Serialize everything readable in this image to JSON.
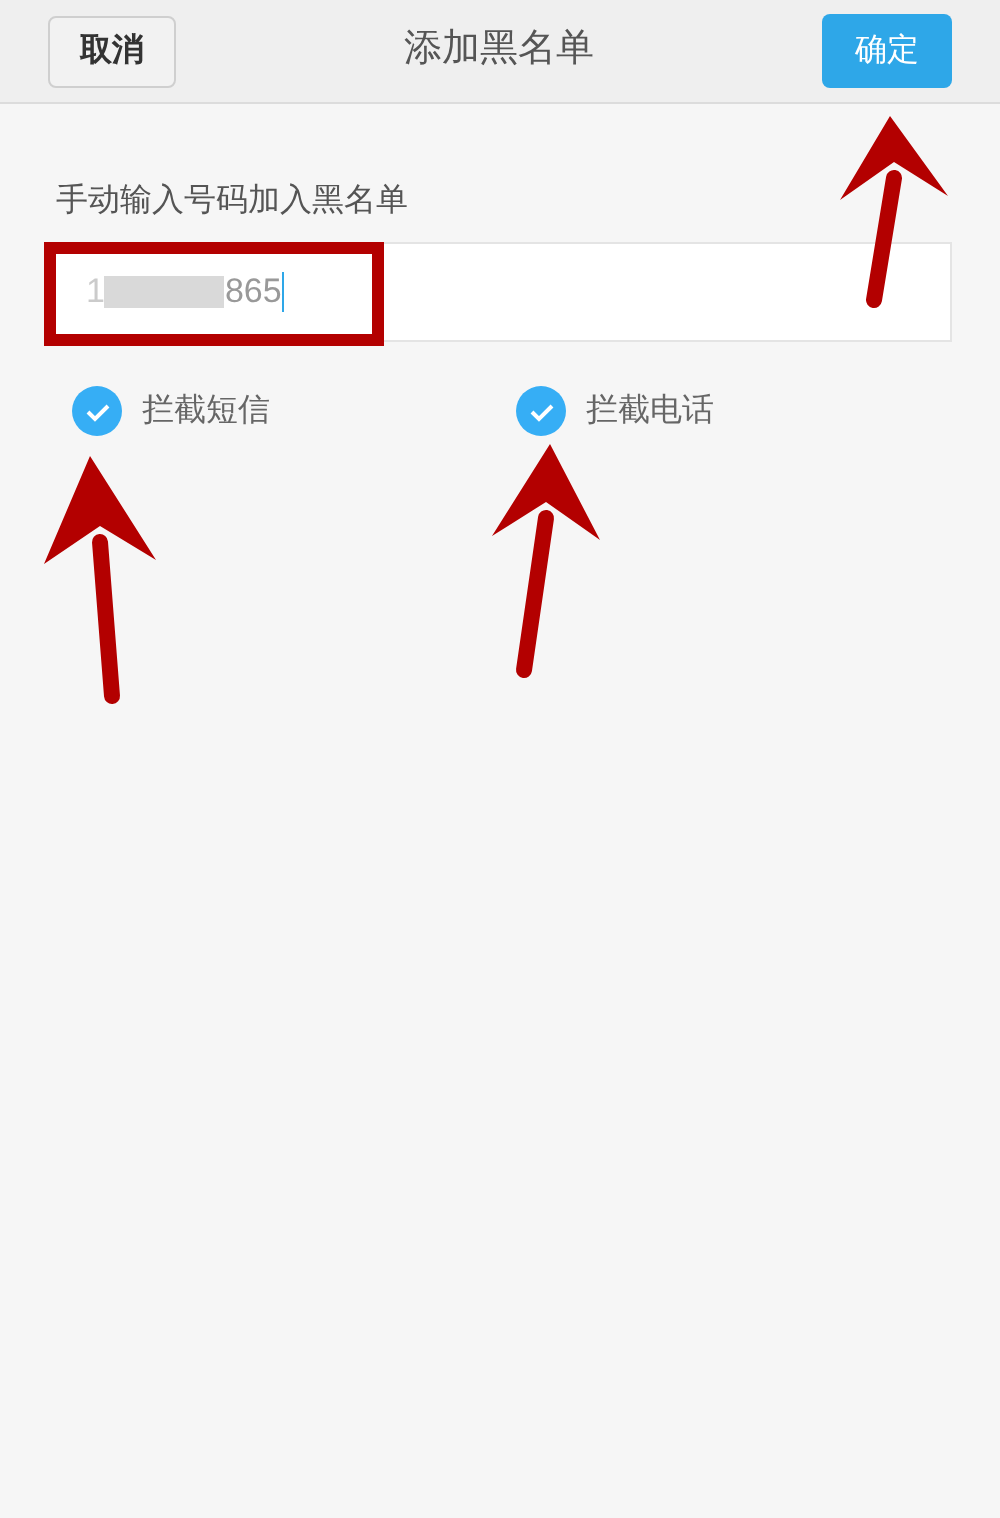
{
  "header": {
    "cancel": "取消",
    "title": "添加黑名单",
    "confirm": "确定"
  },
  "form": {
    "label": "手动输入号码加入黑名单",
    "value_start": "1",
    "value_end": "865"
  },
  "options": [
    {
      "label": "拦截短信",
      "checked": true
    },
    {
      "label": "拦截电话",
      "checked": true
    }
  ]
}
